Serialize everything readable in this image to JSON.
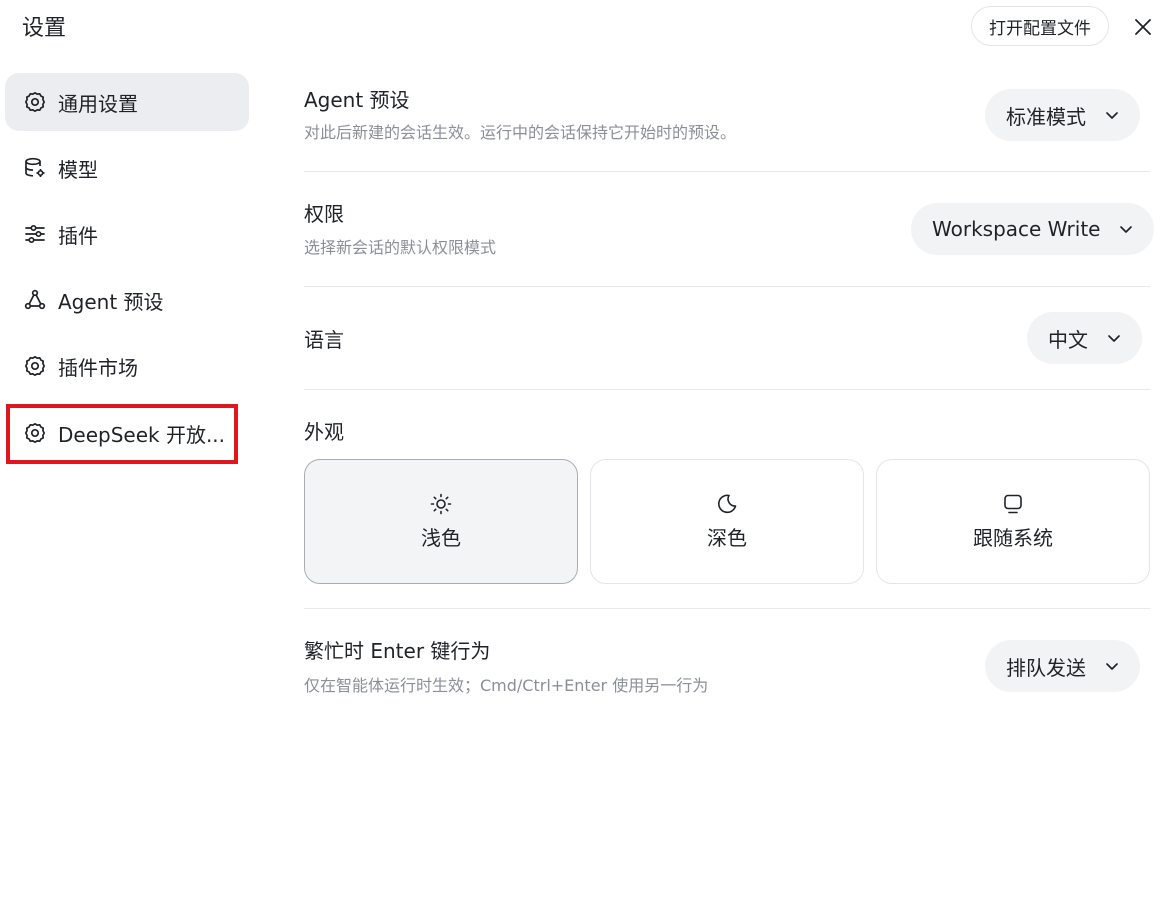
{
  "header": {
    "title": "设置",
    "open_config_label": "打开配置文件"
  },
  "sidebar": {
    "items": [
      {
        "label": "通用设置",
        "icon": "gear-icon",
        "active": true
      },
      {
        "label": "模型",
        "icon": "database-gear-icon",
        "active": false
      },
      {
        "label": "插件",
        "icon": "sliders-icon",
        "active": false
      },
      {
        "label": "Agent 预设",
        "icon": "nodes-icon",
        "active": false
      },
      {
        "label": "插件市场",
        "icon": "gear-icon",
        "active": false
      },
      {
        "label": "DeepSeek 开放...",
        "icon": "gear-icon",
        "active": false,
        "highlighted": true
      }
    ]
  },
  "settings": {
    "agent_preset": {
      "title": "Agent 预设",
      "description": "对此后新建的会话生效。运行中的会话保持它开始时的预设。",
      "value": "标准模式"
    },
    "permission": {
      "title": "权限",
      "description": "选择新会话的默认权限模式",
      "value": "Workspace Write"
    },
    "language": {
      "title": "语言",
      "value": "中文"
    },
    "appearance": {
      "title": "外观",
      "options": [
        {
          "label": "浅色",
          "icon": "sun-icon",
          "selected": true
        },
        {
          "label": "深色",
          "icon": "moon-icon",
          "selected": false
        },
        {
          "label": "跟随系统",
          "icon": "monitor-icon",
          "selected": false
        }
      ]
    },
    "busy_enter": {
      "title": "繁忙时 Enter 键行为",
      "description": "仅在智能体运行时生效；Cmd/Ctrl+Enter 使用另一行为",
      "value": "排队发送"
    }
  },
  "colors": {
    "highlight": "#e0161d",
    "active_bg": "#ebedf0",
    "select_bg": "#f2f3f5",
    "muted_text": "#8a8f98"
  }
}
